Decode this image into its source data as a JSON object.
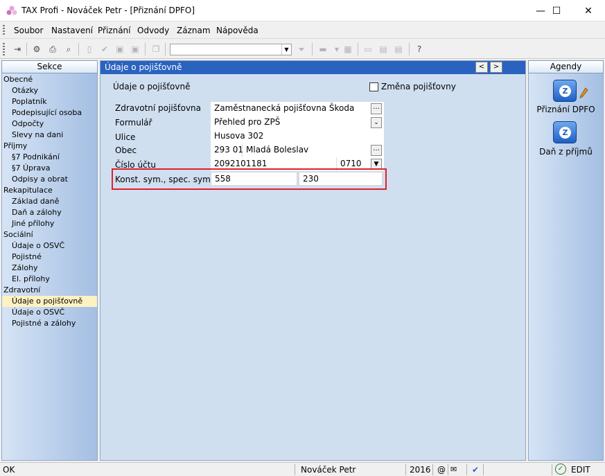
{
  "window": {
    "title": "TAX Profi - Nováček Petr - [Přiznání DPFO]",
    "minimize_icon": "—",
    "maximize_icon": "☐",
    "close_icon": "✕"
  },
  "menu": [
    "Soubor",
    "Nastavení",
    "Přiznání",
    "Odvody",
    "Záznam",
    "Nápověda"
  ],
  "toolbar": {
    "combo_value": ""
  },
  "sections": {
    "header": "Sekce",
    "items": [
      {
        "label": "Obecné",
        "level": 0
      },
      {
        "label": "Otázky",
        "level": 1
      },
      {
        "label": "Poplatník",
        "level": 1
      },
      {
        "label": "Podepisující osoba",
        "level": 1
      },
      {
        "label": "Odpočty",
        "level": 1
      },
      {
        "label": "Slevy na dani",
        "level": 1
      },
      {
        "label": "Příjmy",
        "level": 0
      },
      {
        "label": "§7 Podnikání",
        "level": 1
      },
      {
        "label": "§7 Úprava",
        "level": 1
      },
      {
        "label": "Odpisy a obrat",
        "level": 1
      },
      {
        "label": "Rekapitulace",
        "level": 0
      },
      {
        "label": "Základ daně",
        "level": 1
      },
      {
        "label": "Daň a zálohy",
        "level": 1
      },
      {
        "label": "Jiné přílohy",
        "level": 1
      },
      {
        "label": "Sociální",
        "level": 0
      },
      {
        "label": "Údaje o OSVČ",
        "level": 1
      },
      {
        "label": "Pojistné",
        "level": 1
      },
      {
        "label": "Zálohy",
        "level": 1
      },
      {
        "label": "El. přílohy",
        "level": 1
      },
      {
        "label": "Zdravotní",
        "level": 0
      },
      {
        "label": "Údaje o pojišťovně",
        "level": 1,
        "active": true
      },
      {
        "label": "Údaje o OSVČ",
        "level": 1
      },
      {
        "label": "Pojistné a zálohy",
        "level": 1
      }
    ]
  },
  "content": {
    "header": "Údaje o pojišťovně",
    "nav_prev": "<",
    "nav_next": ">",
    "section_title": "Údaje o pojišťovně",
    "change_checkbox_label": "Změna pojišťovny",
    "change_checked": false,
    "fields": {
      "insurer_label": "Zdravotní pojišťovna",
      "insurer_value": "Zaměstnanecká pojišťovna Škoda",
      "form_label": "Formulář",
      "form_value": "Přehled pro ZPŠ",
      "street_label": "Ulice",
      "street_value": "Husova 302",
      "city_label": "Obec",
      "zip_value": "293 01",
      "city_value": "Mladá Boleslav",
      "account_label": "Číslo účtu",
      "account_value": "2092101181",
      "bank_code_value": "0710",
      "symbols_label": "Konst. sym., spec. sym.",
      "const_sym_value": "558",
      "spec_sym_value": "230"
    }
  },
  "agenda": {
    "header": "Agendy",
    "items": [
      {
        "label": "Přiznání DPFO",
        "icon": "tax-return-icon"
      },
      {
        "label": "Daň z příjmů",
        "icon": "income-tax-icon"
      }
    ]
  },
  "status": {
    "left": "OK",
    "user": "Nováček Petr",
    "year": "2016",
    "at": "@",
    "mode": "EDIT"
  }
}
